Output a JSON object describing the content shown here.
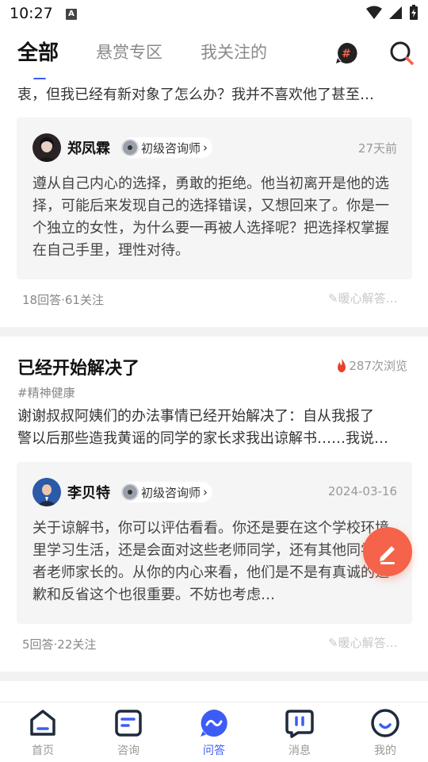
{
  "status_bar": {
    "time": "10:27",
    "badge": "A"
  },
  "tabs": [
    {
      "label": "全部"
    },
    {
      "label": "悬赏专区"
    },
    {
      "label": "我关注的"
    }
  ],
  "icons": {
    "topic": "hashtag-icon",
    "search": "search-icon"
  },
  "feed": {
    "item1": {
      "excerpt": "衷，但我已经有新对象了怎么办？我并不喜欢他了甚至…",
      "answer": {
        "name": "郑凤霖",
        "badge": "初级咨询师",
        "date": "27天前",
        "body": "遵从自己内心的选择，勇敢的拒绝。他当初离开是他的选择，可能后来发现自己的选择错误，又想回来了。你是一个独立的女性，为什么要一再被人选择呢？把选择权掌握在自己手里，理性对待。"
      },
      "stats": "18回答·61关注",
      "reply": "暖心解答…"
    },
    "item2": {
      "title": "已经开始解决了",
      "views": "287次浏览",
      "tag": "#精神健康",
      "excerpt_line1": "谢谢叔叔阿姨们的办法事情已经开始解决了：自从我报了",
      "excerpt_line2": "警以后那些造我黄谣的同学的家长求我出谅解书……我说…",
      "answer": {
        "name": "李贝特",
        "badge": "初级咨询师",
        "date": "2024-03-16",
        "body": "关于谅解书，你可以评估看看。你还是要在这个学校环境里学习生活，还是会面对这些老师同学，还有其他同学或者老师家长的。从你的内心来看，他们是不是有真诚的道歉和反省这个也很重要。不妨也考虑…"
      },
      "stats": "5回答·22关注",
      "reply": "暖心解答…"
    }
  },
  "bottom_nav": [
    {
      "label": "首页",
      "icon": "home-icon"
    },
    {
      "label": "咨询",
      "icon": "consult-icon"
    },
    {
      "label": "问答",
      "icon": "qa-icon"
    },
    {
      "label": "消息",
      "icon": "message-icon"
    },
    {
      "label": "我的",
      "icon": "profile-icon"
    }
  ],
  "colors": {
    "accent": "#3d5cf5",
    "fab": "#f4634a",
    "hot": "#e8432e"
  }
}
